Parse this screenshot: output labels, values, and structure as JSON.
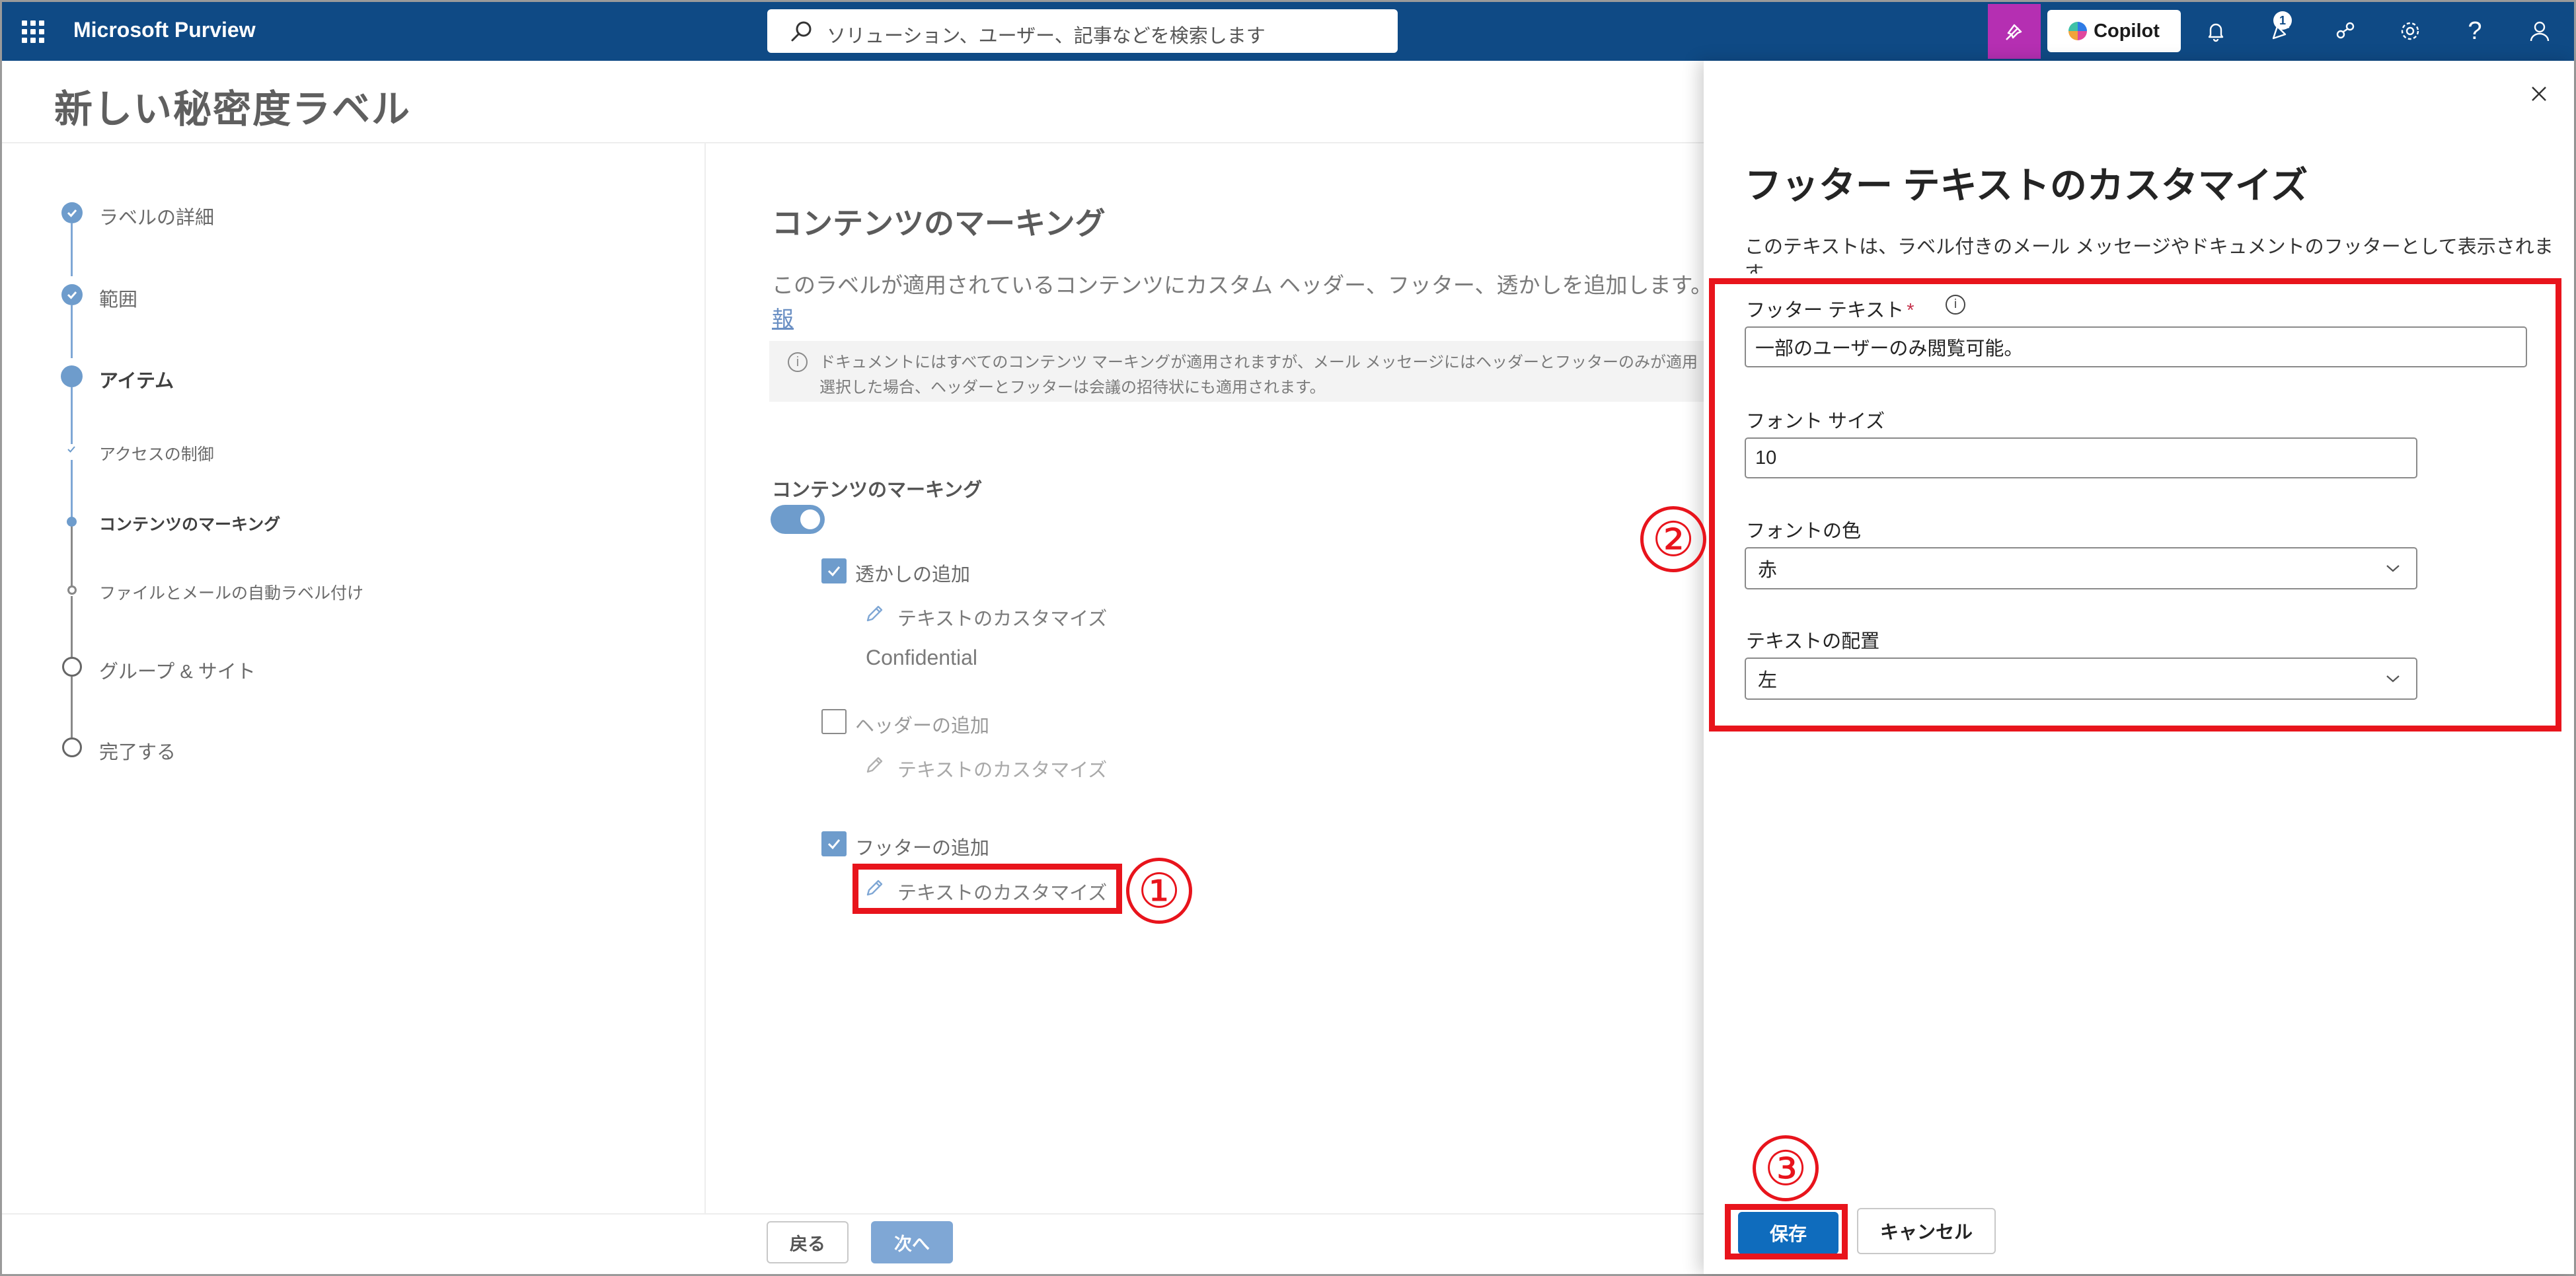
{
  "app": {
    "name": "Microsoft Purview",
    "search_placeholder": "ソリューション、ユーザー、記事などを検索します",
    "copilot_label": "Copilot",
    "notification_badge": "1"
  },
  "page": {
    "title": "新しい秘密度ラベル"
  },
  "stepper": {
    "steps": [
      {
        "label": "ラベルの詳細"
      },
      {
        "label": "範囲"
      },
      {
        "label": "アイテム"
      },
      {
        "label": "アクセスの制御"
      },
      {
        "label": "コンテンツのマーキング"
      },
      {
        "label": "ファイルとメールの自動ラベル付け"
      },
      {
        "label": "グループ & サイト"
      },
      {
        "label": "完了する"
      }
    ]
  },
  "main": {
    "heading": "コンテンツのマーキング",
    "description": "このラベルが適用されているコンテンツにカスタム ヘッダー、フッター、透かしを追加します。",
    "description_link": "報",
    "info_line1": "ドキュメントにはすべてのコンテンツ マーキングが適用されますが、メール メッセージにはヘッダーとフッターのみが適用",
    "info_line2": "選択した場合、ヘッダーとフッターは会議の招待状にも適用されます。",
    "toggle_label": "コンテンツのマーキング",
    "watermark_label": "透かしの追加",
    "watermark_customize": "テキストのカスタマイズ",
    "watermark_text": "Confidential",
    "header_label": "ヘッダーの追加",
    "header_customize": "テキストのカスタマイズ",
    "footer_label": "フッターの追加",
    "footer_customize": "テキストのカスタマイズ"
  },
  "nav": {
    "back_label": "戻る",
    "next_label": "次へ"
  },
  "panel": {
    "title": "フッター テキストのカスタマイズ",
    "description_line1": "このテキストは、ラベル付きのメール メッセージやドキュメントのフッターとして表示されま",
    "description_line2": "す。",
    "footer_text_label": "フッター テキスト",
    "required_mark": "*",
    "footer_text_value": "一部のユーザーのみ閲覧可能。",
    "font_size_label": "フォント サイズ",
    "font_size_value": "10",
    "font_color_label": "フォントの色",
    "font_color_value": "赤",
    "alignment_label": "テキストの配置",
    "alignment_value": "左",
    "save_label": "保存",
    "cancel_label": "キャンセル"
  },
  "annotations": {
    "marker_1": "①",
    "marker_2": "②",
    "marker_3": "③",
    "color": "#e8141c"
  },
  "colors": {
    "topbar": "#0f4a85",
    "accent": "#6e9ccc",
    "primary_button": "#0f6cbd",
    "copilot_tile": "#b52fb2"
  }
}
